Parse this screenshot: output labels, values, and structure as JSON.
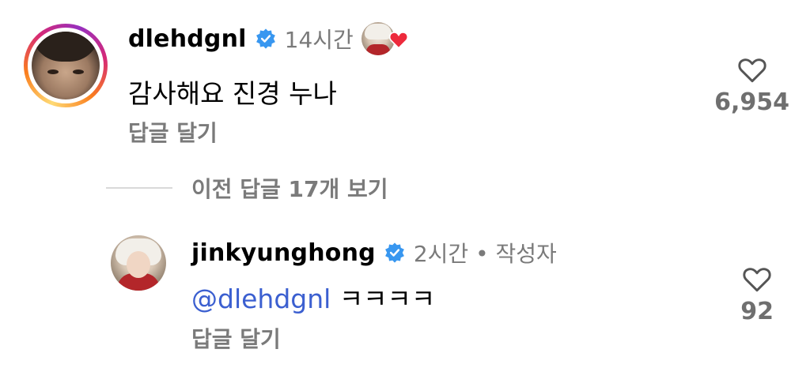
{
  "comments": [
    {
      "username": "dlehdgnl",
      "time": "14시간",
      "text": "감사해요 진경 누나",
      "reply_label": "답글 달기",
      "likes": "6,954"
    }
  ],
  "view_previous": "이전 답글 17개 보기",
  "replies": [
    {
      "username": "jinkyunghong",
      "meta": "2시간 • 작성자",
      "mention": "@dlehdgnl",
      "text": "ㅋㅋㅋㅋ",
      "reply_label": "답글 달기",
      "likes": "92"
    }
  ],
  "icons": {
    "verified": "verified-badge-icon",
    "like": "heart-outline-icon",
    "creator_liked": "heart-filled-icon"
  },
  "colors": {
    "verified": "#3897f0",
    "heart_red": "#ed2a3c",
    "mention": "#3b5fd0",
    "secondary_text": "#7a7a7a"
  }
}
